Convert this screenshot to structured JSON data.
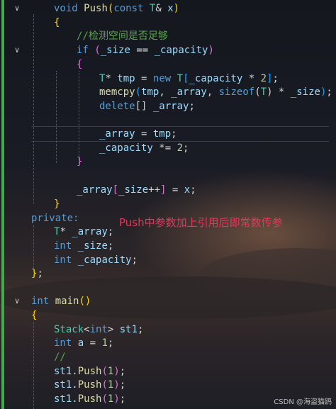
{
  "lines": [
    "void Push(const T& x)",
    "{",
    "//检测空间是否足够",
    "if (_size == _capacity)",
    "{",
    "T* tmp = new T[_capacity * 2];",
    "memcpy(tmp, _array, sizeof(T) * _size);",
    "delete[] _array;",
    "_array = tmp;",
    "_capacity *= 2;",
    "}",
    "_array[_size++] = x;",
    "}",
    "private:",
    "T* _array;",
    "int _size;",
    "int _capacity;",
    "};",
    "int main()",
    "{",
    "Stack<int> st1;",
    "int a = 1;",
    "//",
    "st1.Push(1);",
    "st1.Push(1);",
    "st1.Push(1);"
  ],
  "annotation": "Push中参数加上引用后即常数传参",
  "watermark": "CSDN @海盗猫鸥",
  "colors": {
    "keyword": "#569cd6",
    "type": "#4ec9b0",
    "function": "#dcdcaa",
    "comment": "#57a64a",
    "number": "#b5cea8",
    "annotation": "#e8365a",
    "gutter_bar": "#3fae4a"
  },
  "icons": [
    "fold-chevron-icon"
  ]
}
